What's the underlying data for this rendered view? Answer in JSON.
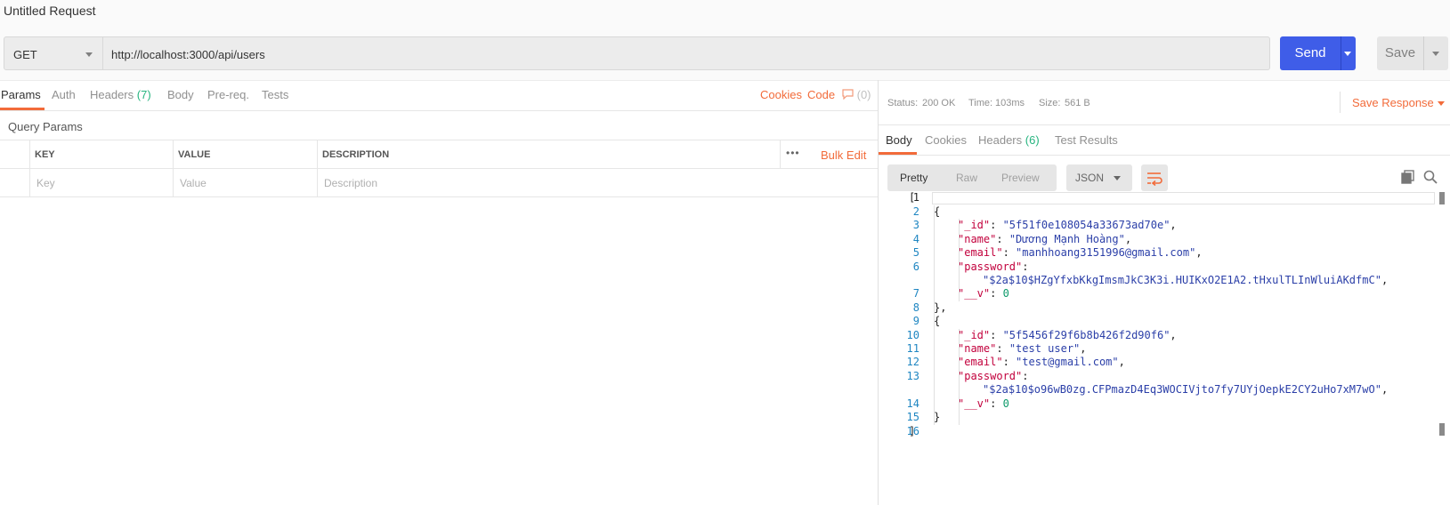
{
  "window": {
    "title": "Untitled Request"
  },
  "request": {
    "method": "GET",
    "url": "http://localhost:3000/api/users",
    "send_label": "Send",
    "save_label": "Save"
  },
  "request_tabs": {
    "params": "Params",
    "auth": "Auth",
    "headers": "Headers",
    "headers_count": "(7)",
    "body": "Body",
    "prereq": "Pre-req.",
    "tests": "Tests",
    "cookies": "Cookies",
    "code": "Code",
    "comments_count": "(0)"
  },
  "params": {
    "section_title": "Query Params",
    "columns": {
      "key": "KEY",
      "value": "VALUE",
      "description": "DESCRIPTION"
    },
    "more_icon": "•••",
    "bulk_edit": "Bulk Edit",
    "placeholders": {
      "key": "Key",
      "value": "Value",
      "description": "Description"
    }
  },
  "response": {
    "status_label": "Status:",
    "status_value": "200 OK",
    "time_label": "Time:",
    "time_value": "103ms",
    "size_label": "Size:",
    "size_value": "561 B",
    "save_response": "Save Response",
    "tabs": {
      "body": "Body",
      "cookies": "Cookies",
      "headers": "Headers",
      "headers_count": "(6)",
      "test_results": "Test Results"
    },
    "view": {
      "pretty": "Pretty",
      "raw": "Raw",
      "preview": "Preview",
      "format": "JSON"
    },
    "line_numbers": [
      "1",
      "2",
      "3",
      "4",
      "5",
      "6",
      "7",
      "8",
      "9",
      "10",
      "11",
      "12",
      "13",
      "14",
      "15",
      "16"
    ],
    "code": {
      "open_bracket": "[",
      "close_bracket": "]",
      "obj_open": "{",
      "obj_close_comma": "},",
      "obj_close": "}",
      "items": [
        {
          "id_key": "\"_id\"",
          "id": "\"5f51f0e108054a33673ad70e\"",
          "name_key": "\"name\"",
          "name": "\"Dương Mạnh Hoàng\"",
          "email_key": "\"email\"",
          "email": "\"manhhoang3151996@gmail.com\"",
          "password_key": "\"password\"",
          "password": "\"$2a$10$HZgYfxbKkgImsmJkC3K3i.HUIKxO2E1A2.tHxulTLInWluiAKdfmC\"",
          "v_key": "\"__v\"",
          "v": "0"
        },
        {
          "id_key": "\"_id\"",
          "id": "\"5f5456f29f6b8b426f2d90f6\"",
          "name_key": "\"name\"",
          "name": "\"test user\"",
          "email_key": "\"email\"",
          "email": "\"test@gmail.com\"",
          "password_key": "\"password\"",
          "password": "\"$2a$10$o96wB0zg.CFPmazD4Eq3WOCIVjto7fy7UYjOepkE2CY2uHo7xM7wO\"",
          "v_key": "\"__v\"",
          "v": "0"
        }
      ]
    }
  },
  "colors": {
    "accent": "#f26b3a",
    "send": "#3f5de8",
    "status_ok": "#26b47f"
  }
}
